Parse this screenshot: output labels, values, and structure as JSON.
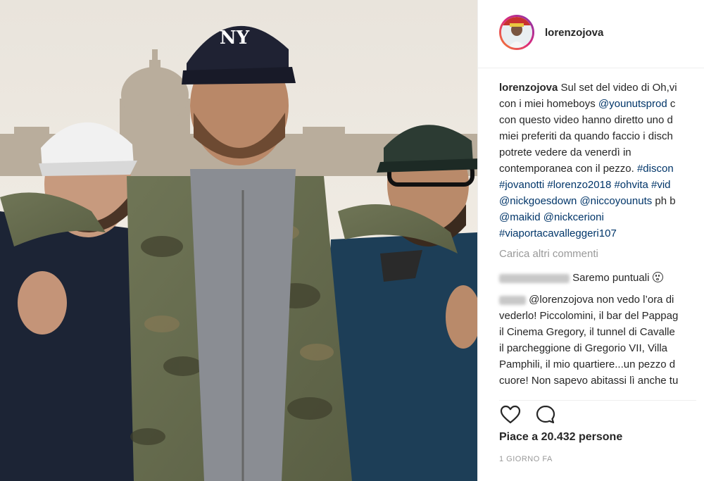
{
  "post": {
    "username": "lorenzojova",
    "caption": {
      "username": "lorenzojova",
      "line1_text": "Sul set del video di Oh,vi",
      "line2_text": "con i miei homeboys ",
      "line2_mention": "@younutsprod",
      "line2_tail": " c",
      "line3": "con questo video hanno diretto uno d",
      "line4": "miei preferiti da quando faccio i disch",
      "line5": "potrete vedere da venerdì in",
      "line6_text": "contemporanea con il pezzo. ",
      "line6_tag": "#discon",
      "line7_tags": "#jovanotti #lorenzo2018 #ohvita #vid",
      "line8_mentions": "@nickgoesdown @niccoyounuts",
      "line8_tail": " ph b",
      "line9_mentions": "@maikid @nickcerioni",
      "line10_tag": "#viaportacavalleggeri107"
    },
    "load_more": "Carica altri commenti",
    "comments": [
      {
        "text": "Saremo puntuali"
      },
      {
        "mention": "@lorenzojova",
        "line1_tail": " non vedo l’ora di",
        "line2": "vederlo! Piccolomini, il bar del Pappag",
        "line3": "il Cinema Gregory, il tunnel di Cavalle",
        "line4": "il parcheggione di Gregorio VII, Villa",
        "line5": "Pamphili, il mio quartiere...un pezzo d",
        "line6": "cuore! Non sapevo abitassi lì anche tu"
      }
    ],
    "likes": "Piace a 20.432 persone",
    "date": "1 GIORNO FA",
    "icons": {
      "like": "heart-icon",
      "comment": "comment-bubble-icon"
    },
    "colors": {
      "text": "#262626",
      "link": "#003569",
      "muted": "#999999"
    }
  }
}
